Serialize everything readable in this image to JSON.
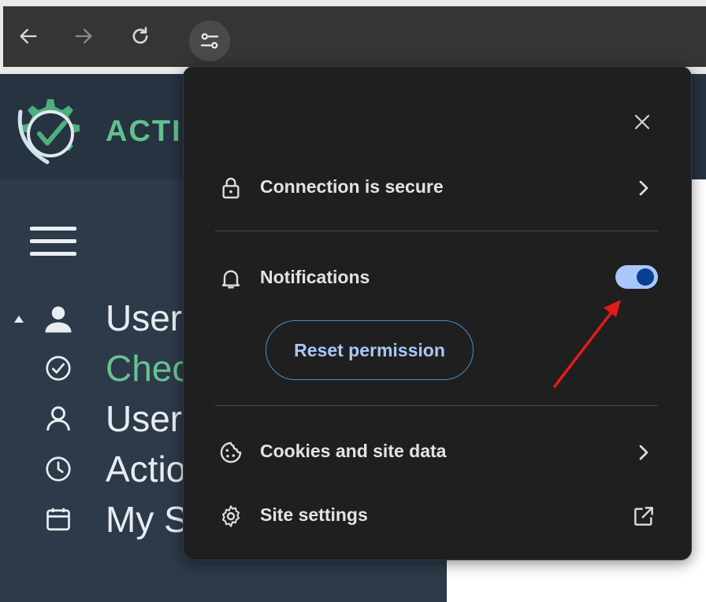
{
  "browser": {
    "nav_icons": [
      "back-arrow-icon",
      "forward-arrow-icon",
      "reload-icon"
    ],
    "site_info_icon": "tune-icon"
  },
  "site": {
    "logo_text": "ACTI",
    "brand_color": "#62c08d",
    "sidebar_items": [
      {
        "label": "User",
        "icon": "person-icon",
        "expanded": true
      },
      {
        "label": "Chec",
        "icon": "check-circle-icon",
        "active": true
      },
      {
        "label": "User",
        "icon": "user-outline-icon"
      },
      {
        "label": "Actio",
        "icon": "clock-icon"
      },
      {
        "label": "My Schedule",
        "icon": "calendar-icon"
      }
    ]
  },
  "popup": {
    "connection_label": "Connection is secure",
    "notifications_label": "Notifications",
    "notifications_enabled": true,
    "reset_label": "Reset permission",
    "cookies_label": "Cookies and site data",
    "site_settings_label": "Site settings",
    "accent": "#a8c7fa"
  },
  "annotation": {
    "arrow_color": "#e31b1b"
  }
}
